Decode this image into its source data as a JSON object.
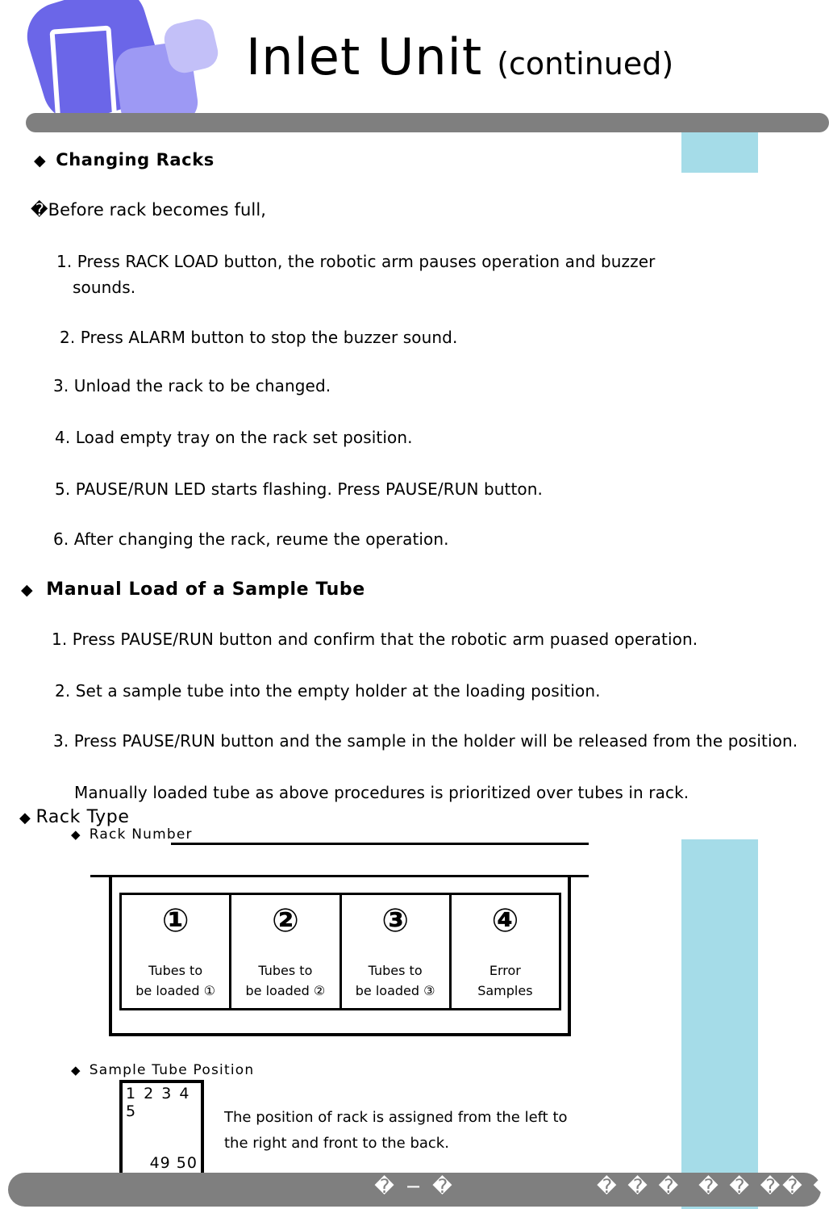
{
  "header": {
    "title": "Inlet Unit",
    "title_suffix": "(continued)",
    "logo_icon": "stacked-rounded-squares-logo"
  },
  "colors": {
    "logo_dark": "#6B66E8",
    "logo_mid": "#9D99F4",
    "logo_light": "#C3C0F8",
    "rule_gray": "#7F7F7F",
    "accent_blue": "#A5DCE8",
    "text": "#000000"
  },
  "sections": {
    "changing_racks": {
      "bullet": "◆",
      "heading": "Changing Racks",
      "intro": "�Before rack becomes full,",
      "steps": [
        "1. Press RACK LOAD button, the robotic arm pauses operation and buzzer",
        "sounds.",
        "2. Press ALARM button to stop the buzzer sound.",
        "3. Unload the rack to be changed.",
        "4. Load empty tray on the rack set position.",
        "5. PAUSE/RUN LED starts flashing. Press PAUSE/RUN button.",
        "6. After changing the rack, reume the operation."
      ]
    },
    "manual_load": {
      "bullet": "◆",
      "heading": "Manual Load of a Sample Tube",
      "steps": [
        "1. Press PAUSE/RUN button and confirm that the robotic arm puased operation.",
        "2. Set a sample tube into the empty holder at the loading position.",
        "3. Press PAUSE/RUN button and the sample in the holder will  be released from the position."
      ],
      "note": "Manually loaded tube as above procedures is prioritized over tubes in rack."
    },
    "rack_type": {
      "bullet": "◆",
      "heading": "Rack Type",
      "rack_number": {
        "bullet": "◆",
        "heading": "Rack Number",
        "cells": [
          {
            "number": "①",
            "label_line1": "Tubes to",
            "label_line2": "be loaded ①"
          },
          {
            "number": "②",
            "label_line1": "Tubes to",
            "label_line2": "be loaded ②"
          },
          {
            "number": "③",
            "label_line1": "Tubes to",
            "label_line2": "be loaded ③"
          },
          {
            "number": "④",
            "label_line1": "Error",
            "label_line2": "Samples"
          }
        ]
      },
      "sample_tube_position": {
        "bullet": "◆",
        "heading": "Sample Tube Position",
        "first_row": "1  2  3  4  5",
        "last_row": "49  50",
        "description_line1": "The position of rack is assigned from the left to",
        "description_line2": "the right and front to the back."
      }
    }
  },
  "footer": {
    "page_number": "� − �",
    "right_group1": "� � �",
    "right_group2": "� � �� � � � ."
  }
}
